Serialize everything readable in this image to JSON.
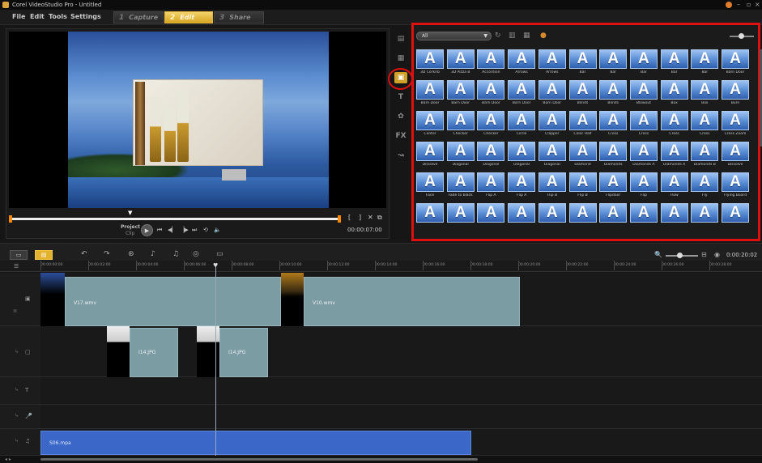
{
  "window": {
    "title": "Corel VideoStudio Pro - Untitled",
    "minimize": "–",
    "maximize": "▫",
    "close": "×"
  },
  "menu": {
    "items": [
      "File",
      "Edit",
      "Tools",
      "Settings"
    ]
  },
  "steps": [
    {
      "num": "1",
      "label": "Capture",
      "active": false
    },
    {
      "num": "2",
      "label": "Edit",
      "active": true
    },
    {
      "num": "3",
      "label": "Share",
      "active": false
    }
  ],
  "player": {
    "mode_label": "Project",
    "clip_label": "Clip",
    "timecode": "00:00:07:00",
    "mark_in": "[",
    "mark_out": "]"
  },
  "library": {
    "filter": "All",
    "grid_glyph": "A",
    "transitions": [
      "3D Corkrib",
      "3D Pizza B",
      "Accordion",
      "Arrows",
      "Arrows",
      "Bar",
      "Bar",
      "Bar",
      "Bar",
      "Bar",
      "Barn Door",
      "Barn Door",
      "Barn Door",
      "Barn Door",
      "Barn Door",
      "Barn Door",
      "Blinds",
      "Blinds",
      "Blowout",
      "Box",
      "Box",
      "Burn",
      "Center",
      "Checker",
      "Checker",
      "Circle",
      "Clapper",
      "Color Half",
      "Cross",
      "Cross",
      "Cross",
      "Cross",
      "Cross Zoom",
      "Dissolve",
      "Diagonal",
      "Diagonal",
      "Diagonal",
      "Diagonal",
      "Diamond",
      "Diamonds",
      "Diamonds A",
      "Diamonds A",
      "Diamonds B",
      "Dissolve",
      "Face",
      "Fade to black",
      "Flip A",
      "Flip A",
      "Flip B",
      "Flip B",
      "Flipdoor",
      "Flip",
      "Flow",
      "Fly",
      "Flying Board",
      "",
      "",
      "",
      "",
      "",
      "",
      "",
      "",
      "",
      "",
      ""
    ]
  },
  "timeline": {
    "duration": "0:00:20:02",
    "ruler": [
      "00:00:00:00",
      "00:00:02:00",
      "00:00:04:00",
      "00:00:06:00",
      "00:00:08:00",
      "00:00:10:00",
      "00:00:12:00",
      "00:00:14:00",
      "00:00:16:00",
      "00:00:18:00",
      "00:00:20:00",
      "00:00:22:00",
      "00:00:24:00",
      "00:00:26:00",
      "00:00:28:00"
    ],
    "clips": {
      "video1": "V17.wmv",
      "video2": "V10.wmv",
      "overlay1": "I14.JPG",
      "overlay2": "I14.JPG",
      "music": "S06.mpa"
    }
  },
  "colors": {
    "accent": "#e3b22e",
    "highlight": "#e01010",
    "audio_clip": "#3a67c8",
    "video_clip": "#7c9ca4"
  }
}
